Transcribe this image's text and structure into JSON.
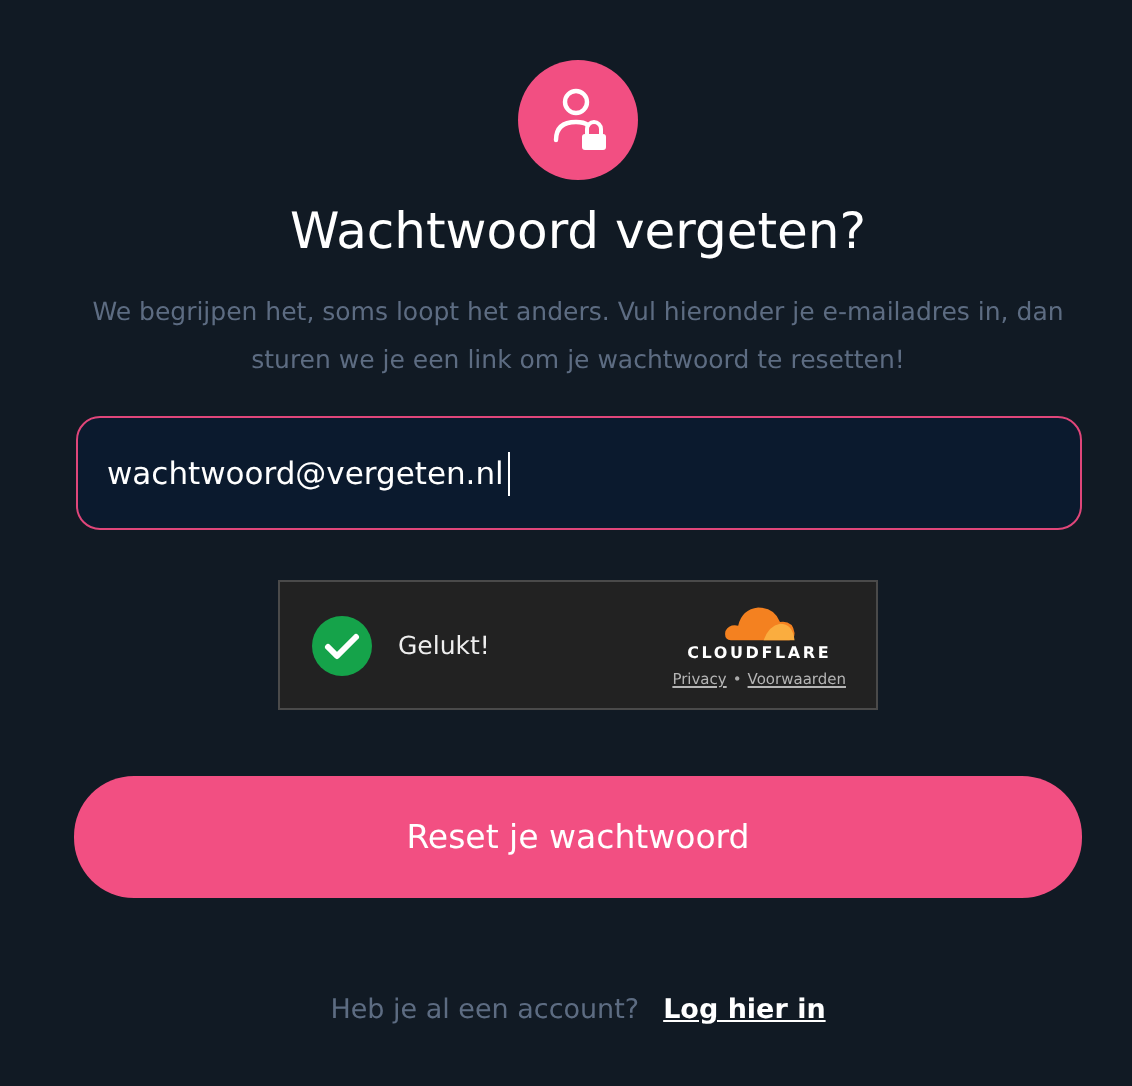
{
  "title": "Wachtwoord vergeten?",
  "subtitle": "We begrijpen het, soms loopt het anders. Vul hieronder je e-mailadres in, dan sturen we je een link om je wachtwoord te resetten!",
  "email_field": {
    "value": "wachtwoord@vergeten.nl"
  },
  "captcha": {
    "verified": true,
    "status": "Gelukt!",
    "brand": "CLOUDFLARE",
    "links": [
      "Privacy",
      "Voorwaarden"
    ],
    "separator": "•"
  },
  "submit_button": "Reset je wachtwoord",
  "footer": {
    "text": "Heb je al een account?",
    "link": "Log hier in"
  }
}
